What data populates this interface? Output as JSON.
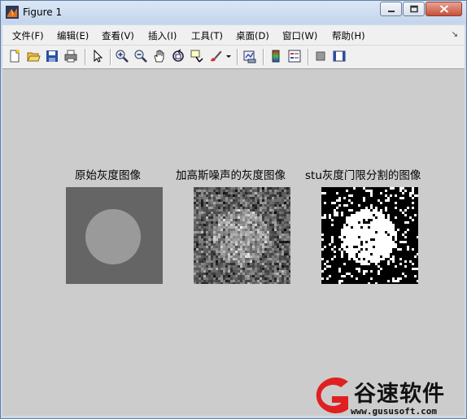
{
  "window": {
    "title": "Figure 1",
    "accent": "#ccd9ea",
    "close_color": "#c7503a"
  },
  "menu": {
    "items": [
      "文件(F)",
      "编辑(E)",
      "查看(V)",
      "插入(I)",
      "工具(T)",
      "桌面(D)",
      "窗口(W)",
      "帮助(H)"
    ]
  },
  "toolbar": {
    "icons": [
      "new-figure-icon",
      "open-file-icon",
      "save-icon",
      "print-icon",
      "pointer-icon",
      "zoom-in-icon",
      "zoom-out-icon",
      "pan-hand-icon",
      "rotate-3d-icon",
      "data-cursor-icon",
      "brush-icon",
      "brush-dropdown-icon",
      "link-plot-icon",
      "colorbar-icon",
      "legend-icon",
      "hide-plot-tools-icon",
      "show-plot-tools-icon"
    ]
  },
  "figure": {
    "background": "#cccccc",
    "panels": [
      {
        "title": "原始灰度图像",
        "kind": "original"
      },
      {
        "title": "加高斯噪声的灰度图像",
        "kind": "noisy"
      },
      {
        "title": "stu灰度门限分割的图像",
        "kind": "threshold"
      }
    ]
  },
  "watermark": {
    "brand": "谷速软件",
    "url": "www.gususoft.com",
    "color": "#e02020"
  }
}
